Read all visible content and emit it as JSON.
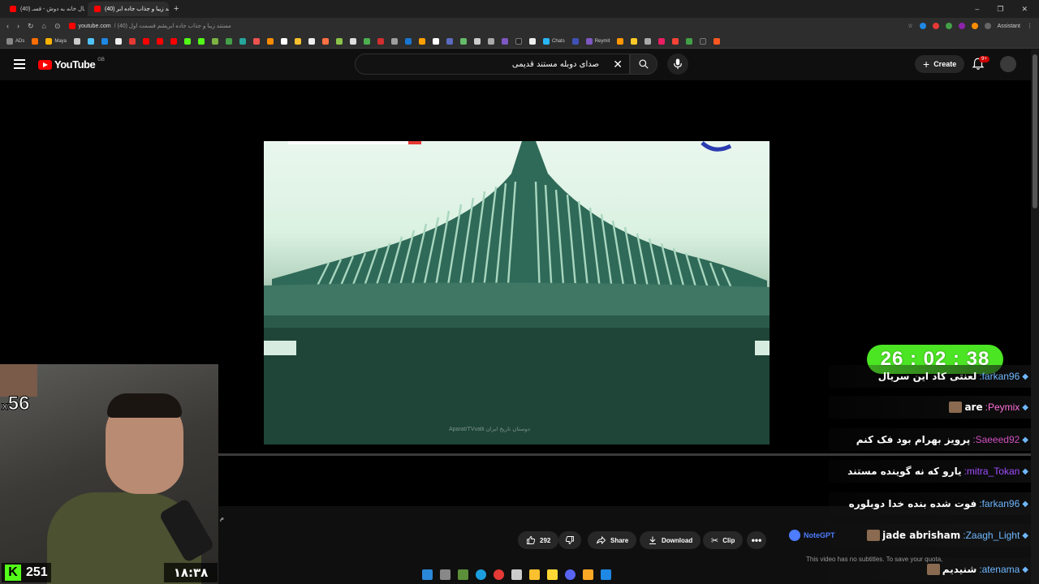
{
  "browser": {
    "tabs": [
      {
        "label": "(40) سریال خانه به دوش - قسـ"
      },
      {
        "label": "(40) مستند زیبا و جذاب جاده ابر"
      }
    ],
    "url_host": "youtube.com",
    "url_path": "/ (40) مستند زیبا و جذاب جاده ابریشم قسمت اول",
    "assistant_label": "Assistant",
    "bookmarks": [
      {
        "label": "ADs"
      },
      {
        "label": "Maya"
      },
      {
        "label": "Chats"
      },
      {
        "label": "Reymit"
      }
    ]
  },
  "youtube": {
    "logo_text": "YouTube",
    "logo_country": "GB",
    "search": {
      "value": "صدای دوبله مستند قدیمی",
      "placeholder": "Search"
    },
    "create_label": "Create",
    "notifications_badge": "9+"
  },
  "video": {
    "watermark": "Aparat/TVvalli  دوستان تاریخ ایران",
    "title_fragment": "م",
    "progress": 0.0
  },
  "actions": {
    "like_count": "292",
    "share_label": "Share",
    "download_label": "Download",
    "clip_label": "Clip"
  },
  "stream": {
    "multiplier": "56",
    "multiplier_prefix": "x",
    "viewers": "251",
    "clock": "۱۸:۳۸",
    "timer": "26 : 02 : 38"
  },
  "chat": [
    {
      "user": ":farkan96",
      "text": "لعنتی کاد این سریال",
      "color": "#6fb8ff",
      "avatar": false
    },
    {
      "user": ":Peymix",
      "text": "are",
      "color": "#ff6fd8",
      "avatar": true
    },
    {
      "user": ":Saeeed92",
      "text": "پرویز بهرام بود فک کنم",
      "color": "#d050c0",
      "avatar": false
    },
    {
      "user": ":mitra_Tokan",
      "text": "یارو که نه گوینده مستند",
      "color": "#a04cff",
      "avatar": false
    },
    {
      "user": ":farkan96",
      "text": "فوت شده بنده خدا دوبلوره",
      "color": "#6fb8ff",
      "avatar": false
    },
    {
      "user": ":Zaagh_Light",
      "text": "jade abrisham",
      "color": "#6fb8ff",
      "avatar": true
    },
    {
      "user": ":atenama",
      "text": "شنیدیم",
      "color": "#6fb8ff",
      "avatar": true
    }
  ],
  "notegpt": {
    "title": "NoteGPT",
    "message": "This video has no subtitles. To save your quota,"
  },
  "colors": {
    "youtube_red": "#ff0000",
    "timer_green": "#4ce524",
    "kick_green": "#53fc18"
  }
}
